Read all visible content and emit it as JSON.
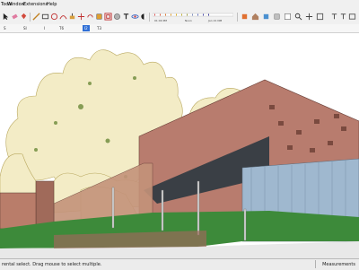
{
  "menu": {
    "items": [
      "Tools",
      "Window",
      "Extensions",
      "Help"
    ]
  },
  "toolbar": {
    "icons": [
      "select-icon",
      "eraser-icon",
      "paint-bucket-icon",
      "line-icon",
      "rectangle-icon",
      "circle-icon",
      "arc-icon",
      "push-pull-icon",
      "move-icon",
      "rotate-icon",
      "scale-icon",
      "offset-icon",
      "tape-measure-icon",
      "text-icon",
      "orbit-icon",
      "pan-icon",
      "zoom-icon",
      "zoom-extents-icon",
      "style-icon",
      "shadow-icon",
      "section-icon",
      "warehouse-icon",
      "extension-warehouse-icon",
      "layout-icon"
    ],
    "shadow_time_labels": [
      "01:00 PM",
      "Noon",
      "Jan 21 NM"
    ]
  },
  "scenes": {
    "tabs": [
      "S",
      "SI",
      "I",
      "T6",
      "I2",
      "T3",
      "T2"
    ],
    "active_index": 3
  },
  "status": {
    "text": "rental select. Drag mouse to select multiple.",
    "measurements_label": "Measurements"
  },
  "colors": {
    "chrome": "#f0f0f0",
    "brick": "#b87c6e",
    "glass": "#9fb8cf",
    "foliage": "#f3ecc6",
    "lawn": "#3d8a3a",
    "active_tab": "#2f6fd6"
  }
}
